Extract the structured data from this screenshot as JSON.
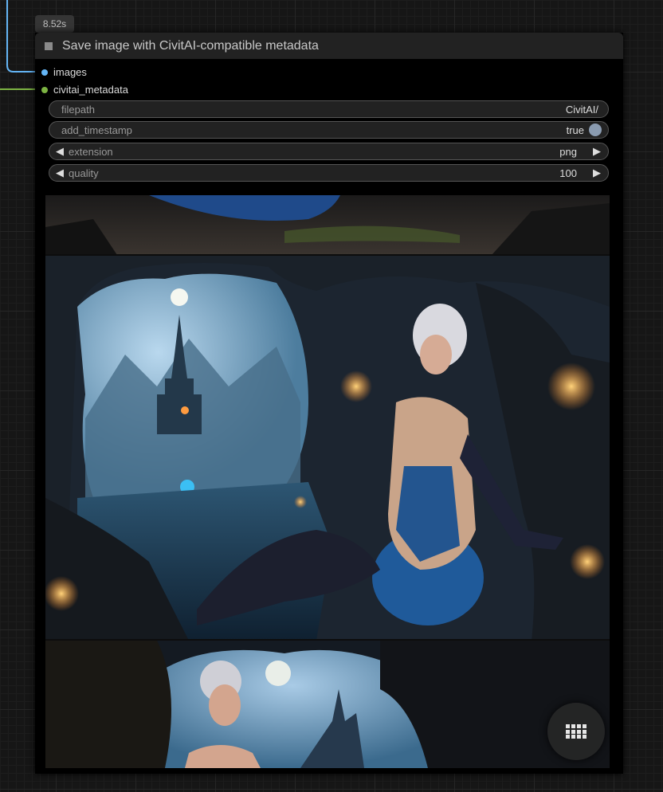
{
  "timer": "8.52s",
  "node": {
    "title": "Save image with CivitAI-compatible metadata",
    "inputs": [
      {
        "label": "images",
        "color": "#64b5f6"
      },
      {
        "label": "civitai_metadata",
        "color": "#7cb342"
      }
    ],
    "widgets": {
      "filepath": {
        "label": "filepath",
        "value": "CivitAI/"
      },
      "add_timestamp": {
        "label": "add_timestamp",
        "value": "true"
      },
      "extension": {
        "label": "extension",
        "value": "png"
      },
      "quality": {
        "label": "quality",
        "value": "100"
      }
    }
  },
  "preview": {
    "icon": "grid-icon"
  }
}
